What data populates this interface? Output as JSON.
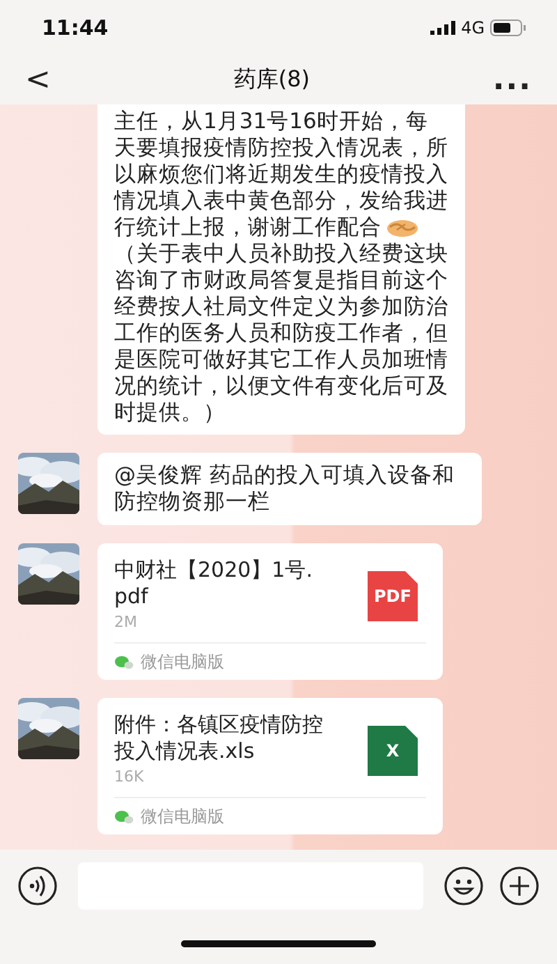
{
  "status_bar": {
    "time": "11:44",
    "network": "4G"
  },
  "nav": {
    "back": "<",
    "title": "药库(8)",
    "more": "..."
  },
  "messages": [
    {
      "kind": "text_emoji",
      "text_before": "主任，从1月31号16时开始，每天要填报疫情防控投入情况表，所以麻烦您们将近期发生的疫情投入情况填入表中黄色部分，发给我进行统计上报，谢谢工作配合",
      "text_after": "（关于表中人员补助投入经费这块咨询了市财政局答复是指目前这个经费按人社局文件定义为参加防治工作的医务人员和防疫工作者，但是医院可做好其它工作人员加班情况的统计，以便文件有变化后可及时提供。）"
    },
    {
      "kind": "text",
      "text": "@吴俊辉 药品的投入可填入设备和防控物资那一栏"
    },
    {
      "kind": "file",
      "color": "#e84444",
      "icon_label": "PDF",
      "name": "中财社【2020】1号.pdf",
      "size": "2M",
      "source": "微信电脑版"
    },
    {
      "kind": "file",
      "color": "#1f7a45",
      "icon_label": "X",
      "name": "附件：各镇区疫情防控投入情况表.xls",
      "size": "16K",
      "source": "微信电脑版"
    }
  ]
}
